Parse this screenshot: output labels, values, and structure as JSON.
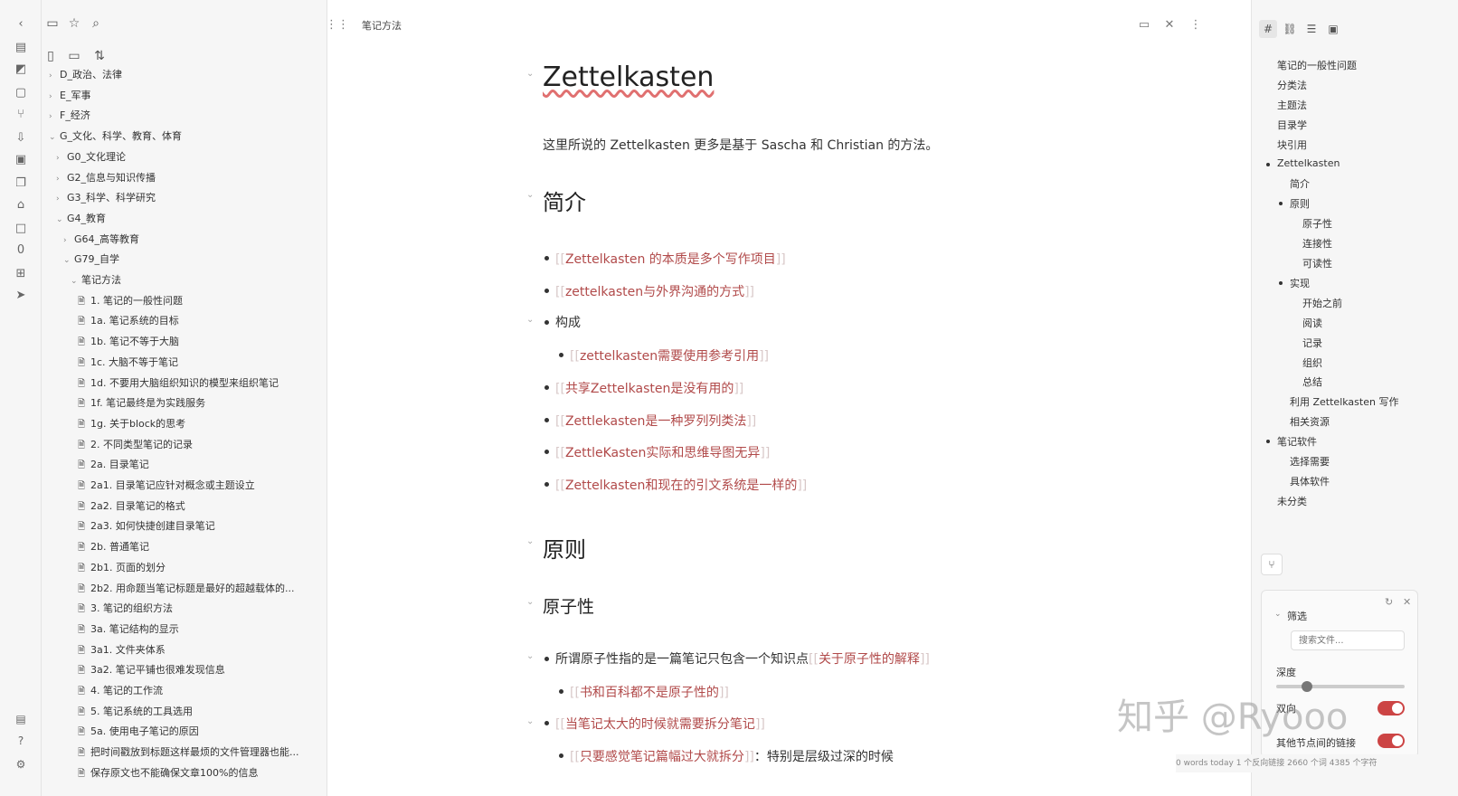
{
  "window": {
    "title": "笔记方法"
  },
  "ribbon": {
    "icons": [
      "collapse-left-icon",
      "files-icon",
      "graph-icon",
      "daily-note-icon",
      "git-icon",
      "sync-icon",
      "calendar-icon",
      "copy-icon",
      "archive-icon",
      "canvas-icon",
      "zero-icon",
      "template-icon",
      "send-icon"
    ],
    "bottom_icons": [
      "vault-icon",
      "help-icon",
      "settings-icon"
    ]
  },
  "explorer": {
    "tree": [
      {
        "label": "D_政治、法律",
        "depth": 0,
        "type": "folder",
        "expanded": false
      },
      {
        "label": "E_军事",
        "depth": 0,
        "type": "folder",
        "expanded": false
      },
      {
        "label": "F_经济",
        "depth": 0,
        "type": "folder",
        "expanded": false
      },
      {
        "label": "G_文化、科学、教育、体育",
        "depth": 0,
        "type": "folder",
        "expanded": true
      },
      {
        "label": "G0_文化理论",
        "depth": 1,
        "type": "folder",
        "expanded": false
      },
      {
        "label": "G2_信息与知识传播",
        "depth": 1,
        "type": "folder",
        "expanded": false
      },
      {
        "label": "G3_科学、科学研究",
        "depth": 1,
        "type": "folder",
        "expanded": false
      },
      {
        "label": "G4_教育",
        "depth": 1,
        "type": "folder",
        "expanded": true
      },
      {
        "label": "G64_高等教育",
        "depth": 2,
        "type": "folder",
        "expanded": false
      },
      {
        "label": "G79_自学",
        "depth": 2,
        "type": "folder",
        "expanded": true
      },
      {
        "label": "笔记方法",
        "depth": 3,
        "type": "folder",
        "expanded": true
      },
      {
        "label": "1. 笔记的一般性问题",
        "depth": 4,
        "type": "file"
      },
      {
        "label": "1a. 笔记系统的目标",
        "depth": 4,
        "type": "file"
      },
      {
        "label": "1b. 笔记不等于大脑",
        "depth": 4,
        "type": "file"
      },
      {
        "label": "1c. 大脑不等于笔记",
        "depth": 4,
        "type": "file"
      },
      {
        "label": "1d. 不要用大脑组织知识的模型来组织笔记",
        "depth": 4,
        "type": "file"
      },
      {
        "label": "1f. 笔记最终是为实践服务",
        "depth": 4,
        "type": "file"
      },
      {
        "label": "1g. 关于block的思考",
        "depth": 4,
        "type": "file"
      },
      {
        "label": "2. 不同类型笔记的记录",
        "depth": 4,
        "type": "file"
      },
      {
        "label": "2a. 目录笔记",
        "depth": 4,
        "type": "file"
      },
      {
        "label": "2a1. 目录笔记应针对概念或主题设立",
        "depth": 4,
        "type": "file"
      },
      {
        "label": "2a2. 目录笔记的格式",
        "depth": 4,
        "type": "file"
      },
      {
        "label": "2a3. 如何快捷创建目录笔记",
        "depth": 4,
        "type": "file"
      },
      {
        "label": "2b. 普通笔记",
        "depth": 4,
        "type": "file"
      },
      {
        "label": "2b1. 页面的划分",
        "depth": 4,
        "type": "file"
      },
      {
        "label": "2b2. 用命题当笔记标题是最好的超越载体的...",
        "depth": 4,
        "type": "file"
      },
      {
        "label": "3. 笔记的组织方法",
        "depth": 4,
        "type": "file"
      },
      {
        "label": "3a. 笔记结构的显示",
        "depth": 4,
        "type": "file"
      },
      {
        "label": "3a1. 文件夹体系",
        "depth": 4,
        "type": "file"
      },
      {
        "label": "3a2. 笔记平铺也很难发现信息",
        "depth": 4,
        "type": "file"
      },
      {
        "label": "4. 笔记的工作流",
        "depth": 4,
        "type": "file"
      },
      {
        "label": "5. 笔记系统的工具选用",
        "depth": 4,
        "type": "file"
      },
      {
        "label": "5a. 使用电子笔记的原因",
        "depth": 4,
        "type": "file"
      },
      {
        "label": "把时间戳放到标题这样最烦的文件管理器也能...",
        "depth": 4,
        "type": "file"
      },
      {
        "label": "保存原文也不能确保文章100%的信息",
        "depth": 4,
        "type": "file"
      }
    ]
  },
  "editor": {
    "tab_title": "笔记方法",
    "h1": "Zettelkasten",
    "intro": "这里所说的 Zettelkasten 更多是基于 Sascha 和 Christian 的方法。",
    "sec1_title": "简介",
    "links1": [
      "Zettelkasten 的本质是多个写作项目",
      "zettelkasten与外界沟通的方式"
    ],
    "gouchen": "构成",
    "sub_link": "zettelkasten需要使用参考引用",
    "links2": [
      "共享Zettelkasten是没有用的",
      "Zettlekasten是一种罗列列类法",
      "ZettleKasten实际和思维导图无异",
      "Zettelkasten和现在的引文系统是一样的"
    ],
    "sec2_title": "原则",
    "sec3_title": "原子性",
    "atom_text": "所谓原子性指的是一篇笔记只包含一个知识点",
    "atom_link": "关于原子性的解释",
    "atom_sub": "书和百科都不是原子性的",
    "split_link": "当笔记太大的时候就需要拆分笔记",
    "split_sub_link": "只要感觉笔记篇幅过大就拆分",
    "split_sub_text": "：特别是层级过深的时候"
  },
  "outline": {
    "items": [
      {
        "label": "笔记的一般性问题",
        "depth": 0,
        "dot": false
      },
      {
        "label": "分类法",
        "depth": 0,
        "dot": false
      },
      {
        "label": "主题法",
        "depth": 0,
        "dot": false
      },
      {
        "label": "目录学",
        "depth": 0,
        "dot": false
      },
      {
        "label": "块引用",
        "depth": 0,
        "dot": false
      },
      {
        "label": "Zettelkasten",
        "depth": 0,
        "dot": true
      },
      {
        "label": "简介",
        "depth": 1,
        "dot": false
      },
      {
        "label": "原则",
        "depth": 1,
        "dot": true
      },
      {
        "label": "原子性",
        "depth": 2,
        "dot": false
      },
      {
        "label": "连接性",
        "depth": 2,
        "dot": false
      },
      {
        "label": "可读性",
        "depth": 2,
        "dot": false
      },
      {
        "label": "实现",
        "depth": 1,
        "dot": true
      },
      {
        "label": "开始之前",
        "depth": 2,
        "dot": false
      },
      {
        "label": "阅读",
        "depth": 2,
        "dot": false
      },
      {
        "label": "记录",
        "depth": 2,
        "dot": false
      },
      {
        "label": "组织",
        "depth": 2,
        "dot": false
      },
      {
        "label": "总结",
        "depth": 2,
        "dot": false
      },
      {
        "label": "利用 Zettelkasten 写作",
        "depth": 1,
        "dot": false
      },
      {
        "label": "相关资源",
        "depth": 1,
        "dot": false
      },
      {
        "label": "笔记软件",
        "depth": 0,
        "dot": true
      },
      {
        "label": "选择需要",
        "depth": 1,
        "dot": false
      },
      {
        "label": "具体软件",
        "depth": 1,
        "dot": false
      },
      {
        "label": "未分类",
        "depth": 0,
        "dot": false
      }
    ]
  },
  "graph": {
    "filter_label": "筛选",
    "search_placeholder": "搜索文件...",
    "depth_label": "深度",
    "depth_value": 0.2,
    "toggle1_label": "双向",
    "toggle2_label": "其他节点间的链接"
  },
  "watermark": "知乎 @Ryooo",
  "status": "0 words today   1 个反向链接   2660 个词   4385 个字符"
}
